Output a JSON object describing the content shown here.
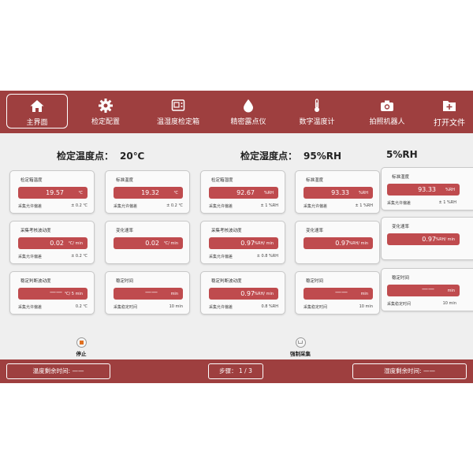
{
  "nav": {
    "items": [
      {
        "label": "主界面",
        "icon": "home-icon"
      },
      {
        "label": "检定配置",
        "icon": "gear-icon"
      },
      {
        "label": "温湿度检定箱",
        "icon": "chamber-icon"
      },
      {
        "label": "精密露点仪",
        "icon": "droplet-icon"
      },
      {
        "label": "数字温度计",
        "icon": "thermometer-icon"
      },
      {
        "label": "拍照机器人",
        "icon": "camera-icon"
      },
      {
        "label": "打开文件",
        "icon": "file-add-icon"
      }
    ],
    "active_index": 0
  },
  "temp_point": {
    "label": "检定温度点：",
    "value": "20℃"
  },
  "hum_point": {
    "label": "检定湿度点：",
    "value": "95%RH"
  },
  "hum_point_partial": "5%RH",
  "cards": {
    "c1": {
      "title": "检定箱温度",
      "value": "19.57",
      "unit": "℃",
      "foot_left": "采集允许偏差",
      "foot_right": "± 0.2 ℃"
    },
    "c2": {
      "title": "标准温度",
      "value": "19.32",
      "unit": "℃",
      "foot_left": "采集允许偏差",
      "foot_right": "± 0.2 ℃"
    },
    "c3": {
      "title": "检定箱湿度",
      "value": "92.67",
      "unit": "%RH",
      "foot_left": "采集允许偏差",
      "foot_right": "± 1 %RH"
    },
    "c4": {
      "title": "标准湿度",
      "value": "93.33",
      "unit": "%RH",
      "foot_left": "采集允许偏差",
      "foot_right": "± 1 %RH"
    },
    "c5": {
      "title": "标准湿度",
      "value": "93.33",
      "unit": "%RH",
      "foot_left": "采集允许偏差",
      "foot_right": "± 1 %RH"
    },
    "c6": {
      "title": "采集考核波动度",
      "value": "0.02",
      "unit": "℃/ min",
      "foot_left": "采集允许偏差",
      "foot_right": "± 0.2 ℃"
    },
    "c7": {
      "title": "变化速率",
      "value": "0.02",
      "unit": "℃/ min"
    },
    "c8": {
      "title": "采集考核波动度",
      "value": "0.97",
      "unit": "%RH/ min",
      "foot_left": "采集允许偏差",
      "foot_right": "± 0.8 %RH"
    },
    "c9": {
      "title": "变化速率",
      "value": "0.97",
      "unit": "%RH/ min"
    },
    "c10": {
      "title": "变化速率",
      "value": "0.97",
      "unit": "%RH/ min"
    },
    "c11": {
      "title": "稳定判断波动度",
      "value": "——",
      "unit": "℃/ 5 min",
      "foot_left": "采集允许偏差",
      "foot_right": "0.2 ℃"
    },
    "c12": {
      "title": "稳定时间",
      "value": "——",
      "unit": "min",
      "foot_left": "采集稳定时间",
      "foot_right": "10 min"
    },
    "c13": {
      "title": "稳定判断波动度",
      "value": "0.97",
      "unit": "%RH/ min",
      "foot_left": "采集允许偏差",
      "foot_right": "0.8 %RH"
    },
    "c14": {
      "title": "稳定时间",
      "value": "——",
      "unit": "min",
      "foot_left": "采集稳定时间",
      "foot_right": "10 min"
    },
    "c15": {
      "title": "稳定时间",
      "value": "——",
      "unit": "min",
      "foot_left": "采集稳定时间",
      "foot_right": "10 min"
    }
  },
  "controls": {
    "stop_label": "停止",
    "force_label": "强制采集"
  },
  "bottom": {
    "temp_remaining": "温度剩余时间: ——",
    "step": "步骤：  1 / 3",
    "hum_remaining": "湿度剩余时间: ——"
  },
  "colors": {
    "brand": "#9e3f3f",
    "value_bar": "#bf4b4e",
    "stop": "#e07020"
  }
}
